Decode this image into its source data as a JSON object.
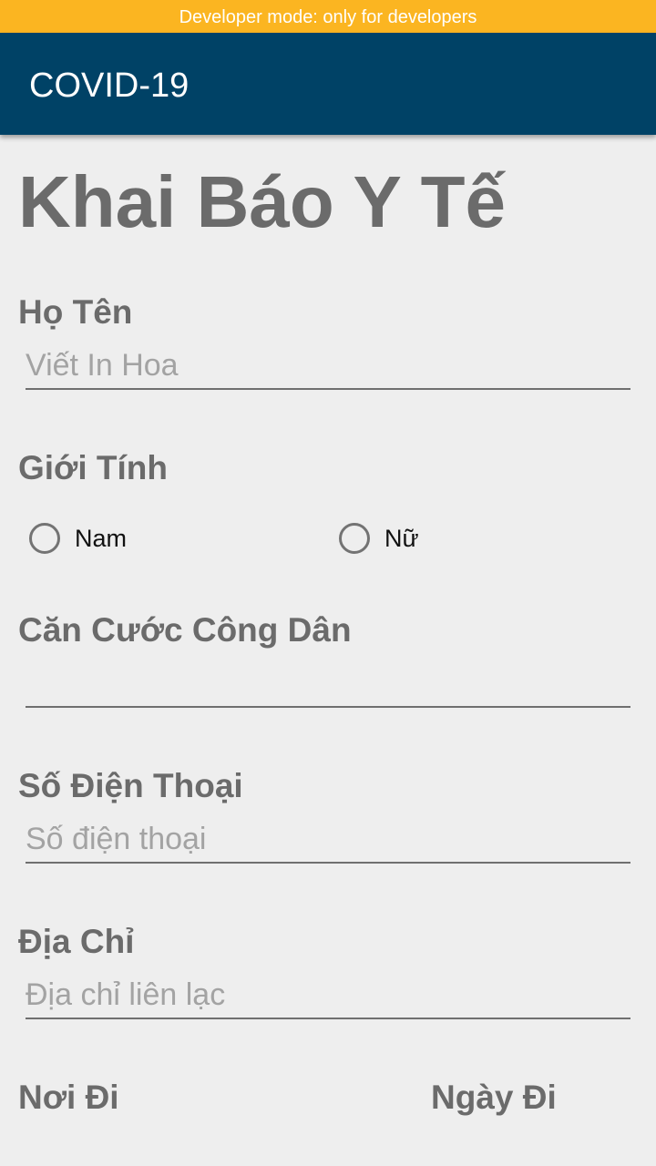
{
  "system": {
    "dev_banner": "Developer mode: only for developers"
  },
  "app_bar": {
    "title": "COVID-19"
  },
  "form": {
    "title": "Khai Báo Y Tế",
    "full_name": {
      "label": "Họ Tên",
      "placeholder": "Viết In Hoa",
      "value": ""
    },
    "gender": {
      "label": "Giới Tính",
      "options": [
        "Nam",
        "Nữ"
      ],
      "selected": null
    },
    "citizen_id": {
      "label": "Căn Cước Công Dân",
      "placeholder": "",
      "value": ""
    },
    "phone": {
      "label": "Số Điện Thoại",
      "placeholder": "Số điện thoại",
      "value": ""
    },
    "address": {
      "label": "Địa Chỉ",
      "placeholder": "Địa chỉ liên lạc",
      "value": ""
    },
    "departure": {
      "label": "Nơi Đi"
    },
    "departure_date": {
      "label": "Ngày Đi"
    }
  },
  "colors": {
    "dev_banner_bg": "#fbb521",
    "app_bar_bg": "#004266",
    "page_bg": "#eeeeee",
    "label_text": "#6b6b6b",
    "placeholder_text": "#a3a3a3"
  }
}
